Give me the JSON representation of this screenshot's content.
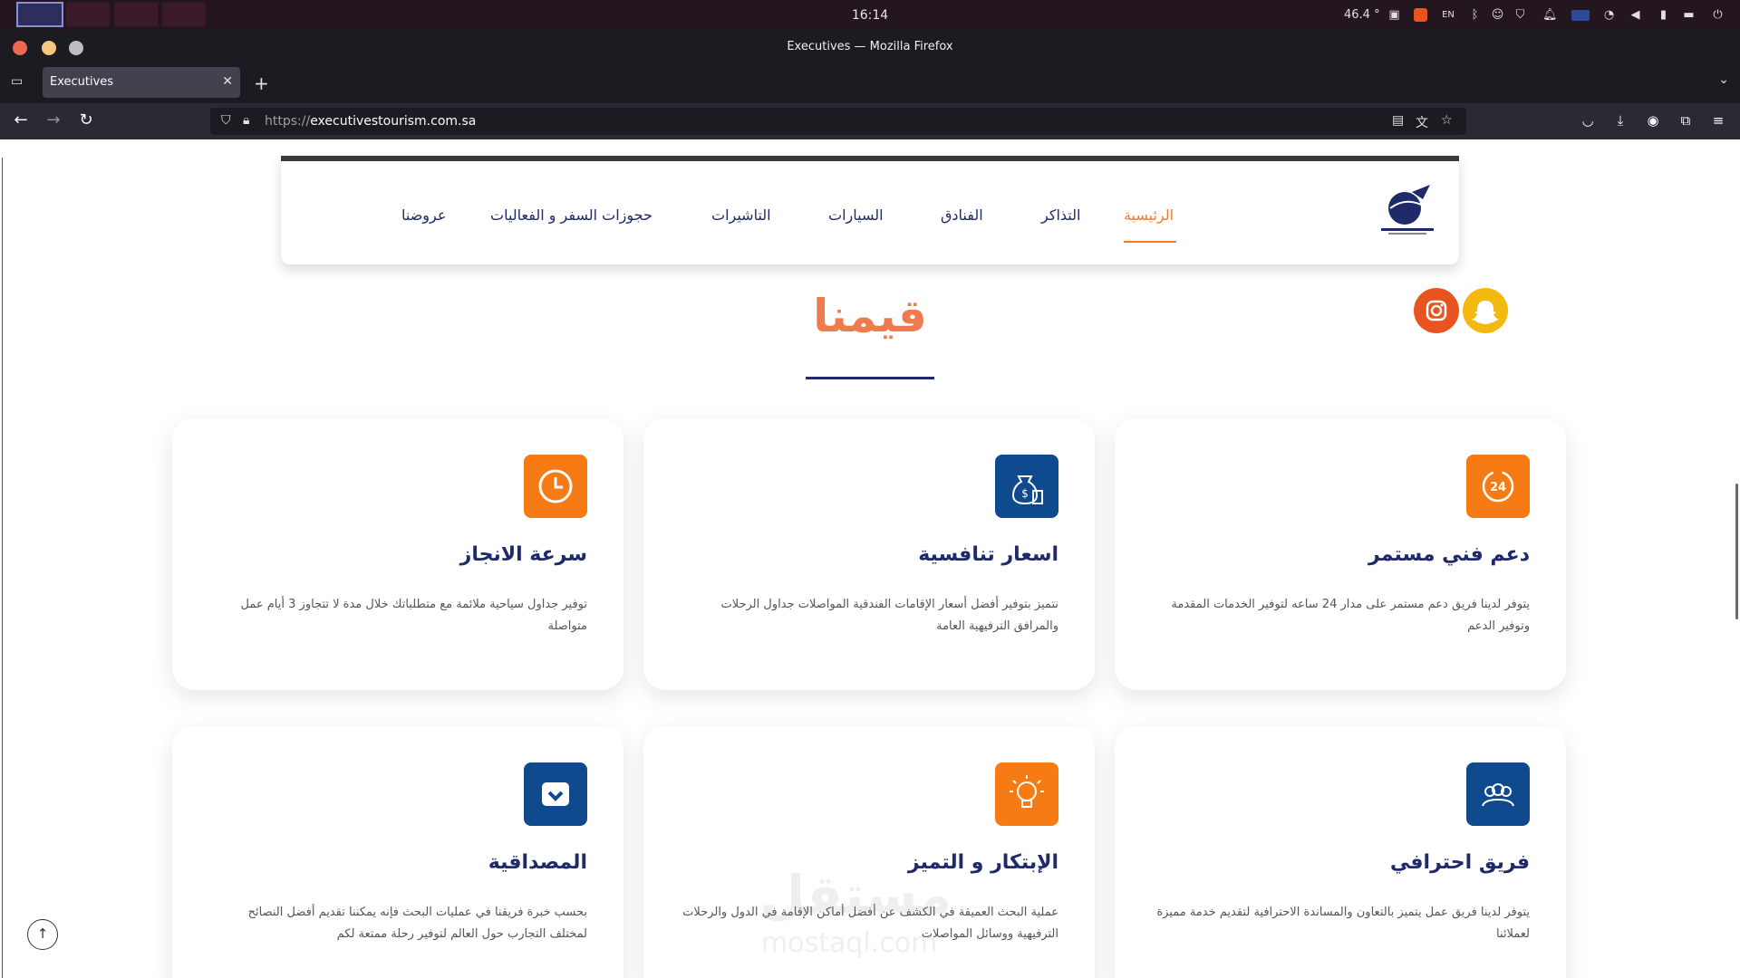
{
  "system": {
    "clock": "16:14",
    "temperature": "46.4 °",
    "language": "EN"
  },
  "window": {
    "title": "Executives — Mozilla Firefox"
  },
  "browser": {
    "tab_title": "Executives",
    "url_prefix": "https://",
    "url_domain": "executivestourism.com.sa"
  },
  "nav": {
    "items": [
      {
        "label": "الرئيسية",
        "active": true
      },
      {
        "label": "التذاكر",
        "active": false
      },
      {
        "label": "الفنادق",
        "active": false
      },
      {
        "label": "السيارات",
        "active": false
      },
      {
        "label": "التاشيرات",
        "active": false
      },
      {
        "label": "حجوزات السفر و الفعاليات",
        "active": false
      },
      {
        "label": "عروضنا",
        "active": false
      }
    ]
  },
  "section": {
    "title": "قيمنا"
  },
  "cards": [
    {
      "title": "دعم فني مستمر",
      "text": "يتوفر لدينا فريق دعم مستمر على مدار 24 ساعه لتوفير الخدمات المقدمة وتوفير الدعم",
      "icon": "24h-clock-icon",
      "color": "#f77b14"
    },
    {
      "title": "اسعار تنافسية",
      "text": "نتميز بتوفير أفضل أسعار الإقامات الفندقية المواصلات جداول الرحلات والمرافق الترفيهية العامة",
      "icon": "money-bag-icon",
      "color": "#0f4a8e"
    },
    {
      "title": "سرعة الانجاز",
      "text": "توفير جداول سياحية ملائمة مع متطلباتك خلال مدة لا تتجاوز 3 أيام عمل متواصلة",
      "icon": "clock-icon",
      "color": "#f77b14"
    },
    {
      "title": "فريق احترافي",
      "text": "يتوفر لدينا فريق عمل يتميز بالتعاون والمساندة الاحترافية لتقديم خدمة مميزة لعملائنا",
      "icon": "team-icon",
      "color": "#0f4a8e"
    },
    {
      "title": "الإبتكار و التميز",
      "text": "عملية البحث العميقة في الكشف عن أفضل أماكن الإقامة في الدول والرحلات الترفيهية ووسائل المواصلات",
      "icon": "lightbulb-icon",
      "color": "#f77b14"
    },
    {
      "title": "المصداقية",
      "text": "بحسب خبرة فريقنا في عمليات البحث فإنه يمكننا تقديم أفضل النصائح لمختلف التجارب حول العالم لتوفير رحلة ممتعة لكم",
      "icon": "shield-check-icon",
      "color": "#0f4a8e"
    }
  ],
  "watermark": {
    "text": "مستقل",
    "sub": "mostaql.com"
  }
}
